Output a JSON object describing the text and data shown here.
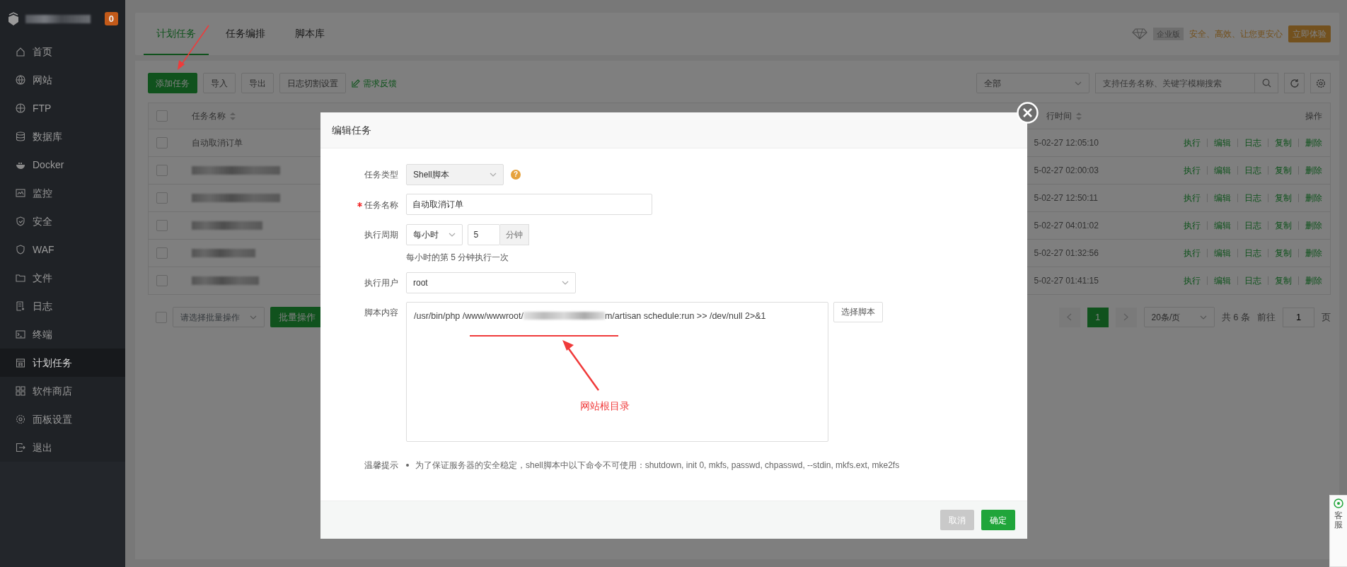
{
  "sidebar": {
    "badge": "0",
    "items": [
      {
        "label": "首页",
        "selected": false
      },
      {
        "label": "网站",
        "selected": false
      },
      {
        "label": "FTP",
        "selected": false
      },
      {
        "label": "数据库",
        "selected": false
      },
      {
        "label": "Docker",
        "selected": false
      },
      {
        "label": "监控",
        "selected": false
      },
      {
        "label": "安全",
        "selected": false
      },
      {
        "label": "WAF",
        "selected": false
      },
      {
        "label": "文件",
        "selected": false
      },
      {
        "label": "日志",
        "selected": false
      },
      {
        "label": "终端",
        "selected": false
      },
      {
        "label": "计划任务",
        "selected": true
      },
      {
        "label": "软件商店",
        "selected": false
      },
      {
        "label": "面板设置",
        "selected": false
      },
      {
        "label": "退出",
        "selected": false
      }
    ]
  },
  "tabs": [
    {
      "label": "计划任务",
      "selected": true
    },
    {
      "label": "任务编排",
      "selected": false
    },
    {
      "label": "脚本库",
      "selected": false
    }
  ],
  "promo": {
    "edition": "企业版",
    "slogan": "安全、高效、让您更安心",
    "button": "立即体验"
  },
  "toolbar": {
    "buttons": [
      {
        "label": "添加任务",
        "kind": "primary"
      },
      {
        "label": "导入",
        "kind": "default"
      },
      {
        "label": "导出",
        "kind": "default"
      },
      {
        "label": "日志切割设置",
        "kind": "default"
      },
      {
        "label": "需求反馈",
        "kind": "link"
      }
    ],
    "filter": "全部",
    "search": {
      "placeholder": "支持任务名称、关键字模糊搜索"
    }
  },
  "table": {
    "all_checked": false,
    "columns": [
      "任务名称",
      "行时间",
      "操作"
    ],
    "rows": [
      {
        "checked": false,
        "name": "自动取消订单",
        "time": "5-02-27 12:05:10",
        "actions": [
          "执行",
          "编辑",
          "日志",
          "复制",
          "删除"
        ]
      },
      {
        "checked": false,
        "time": "5-02-27 02:00:03",
        "actions": [
          "执行",
          "编辑",
          "日志",
          "复制",
          "删除"
        ]
      },
      {
        "checked": false,
        "time": "5-02-27 12:50:11",
        "actions": [
          "执行",
          "编辑",
          "日志",
          "复制",
          "删除"
        ]
      },
      {
        "checked": false,
        "time": "5-02-27 04:01:02",
        "actions": [
          "执行",
          "编辑",
          "日志",
          "复制",
          "删除"
        ]
      },
      {
        "checked": false,
        "time": "5-02-27 01:32:56",
        "actions": [
          "执行",
          "编辑",
          "日志",
          "复制",
          "删除"
        ]
      },
      {
        "checked": false,
        "time": "5-02-27 01:41:15",
        "actions": [
          "执行",
          "编辑",
          "日志",
          "复制",
          "删除"
        ]
      }
    ]
  },
  "batch": {
    "checked": false,
    "placeholder": "请选择批量操作",
    "button": "批量操作"
  },
  "pagination": {
    "pages": [
      {
        "label": "1",
        "selected": true
      }
    ],
    "page_size": "20条/页",
    "total": "共 6 条",
    "goto_label": "前往",
    "goto_value": "1",
    "page_suffix": "页"
  },
  "modal": {
    "title": "编辑任务",
    "fields": [
      {
        "label": "任务类型",
        "kind": "select",
        "required": false,
        "disabled": true,
        "value": "Shell脚本",
        "help": "?"
      },
      {
        "label": "任务名称",
        "kind": "input",
        "required": true,
        "disabled": false,
        "value": "自动取消订单"
      },
      {
        "label": "执行周期",
        "kind": "period",
        "required": false,
        "disabled": false,
        "select": "每小时",
        "value": "5",
        "unit": "分钟",
        "hint": "每小时的第 5 分钟执行一次"
      },
      {
        "label": "执行用户",
        "kind": "select",
        "required": false,
        "disabled": false,
        "value": "root"
      },
      {
        "label": "脚本内容",
        "kind": "script",
        "required": false,
        "disabled": false,
        "lines": [
          "/usr/bin/php /www/wwwroot/",
          "m/artisan schedule:run >> /dev/null 2>&1"
        ],
        "button": "选择脚本"
      }
    ],
    "tips": {
      "label": "温馨提示",
      "items": [
        "为了保证服务器的安全稳定，shell脚本中以下命令不可使用：shutdown, init 0, mkfs, passwd, chpasswd, --stdin, mkfs.ext, mke2fs"
      ]
    },
    "buttons": [
      {
        "label": "取消",
        "kind": "cancel"
      },
      {
        "label": "确定",
        "kind": "confirm"
      }
    ]
  },
  "annotation": {
    "label": "网站根目录"
  },
  "service_tab": {
    "label": "客服"
  }
}
